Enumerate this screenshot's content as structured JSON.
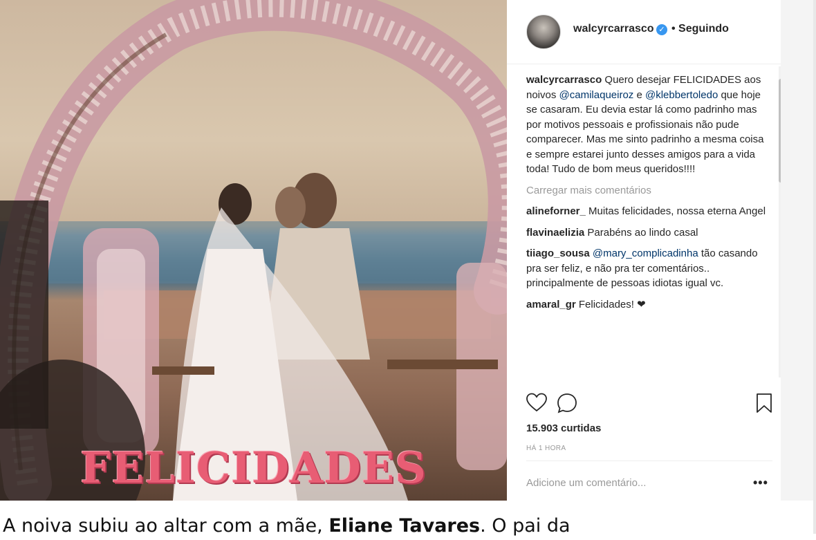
{
  "photo": {
    "overlay_text": "FELICIDADES"
  },
  "post": {
    "header": {
      "username": "walcyrcarrasco",
      "verified_icon": "verified-badge-icon",
      "follow_status": "• Seguindo"
    },
    "caption": {
      "username": "walcyrcarrasco",
      "text_before": " Quero desejar FELICIDADES aos noivos ",
      "mention_1": "@camilaqueiroz",
      "text_mid": " e ",
      "mention_2": "@klebbertoledo",
      "text_after": " que hoje se casaram. Eu devia estar lá como padrinho mas por motivos pessoais e profissionais não pude comparecer. Mas me sinto padrinho a mesma coisa e sempre estarei junto desses amigos para a vida toda! Tudo de bom meus queridos!!!!"
    },
    "load_more": "Carregar mais comentários",
    "comments": [
      {
        "username": "alineforner_",
        "text": " Muitas felicidades, nossa eterna Angel"
      },
      {
        "username": "flavinaelizia",
        "text": " Parabéns ao lindo casal"
      },
      {
        "username": "tiiago_sousa",
        "mention": "@mary_complicadinha",
        "text": " tão casando pra ser feliz, e não pra ter comentários.. principalmente de pessoas idiotas igual vc."
      },
      {
        "username": "amaral_gr",
        "text": " Felicidades! ❤"
      }
    ],
    "actions": {
      "like_icon": "heart-icon",
      "comment_icon": "comment-bubble-icon",
      "save_icon": "bookmark-icon"
    },
    "likes": "15.903 curtidas",
    "timestamp": "HÁ 1 HORA",
    "add_comment_placeholder": "Adicione um comentário...",
    "more_options": "•••"
  },
  "article": {
    "text_before": "A noiva subiu ao altar com a mãe, ",
    "bold": "Eliane Tavares",
    "text_after": ". O pai da"
  },
  "colors": {
    "overlay_pink": "#e85d74",
    "mention_blue": "#003569",
    "verified_blue": "#3897f0",
    "muted_gray": "#999999"
  }
}
